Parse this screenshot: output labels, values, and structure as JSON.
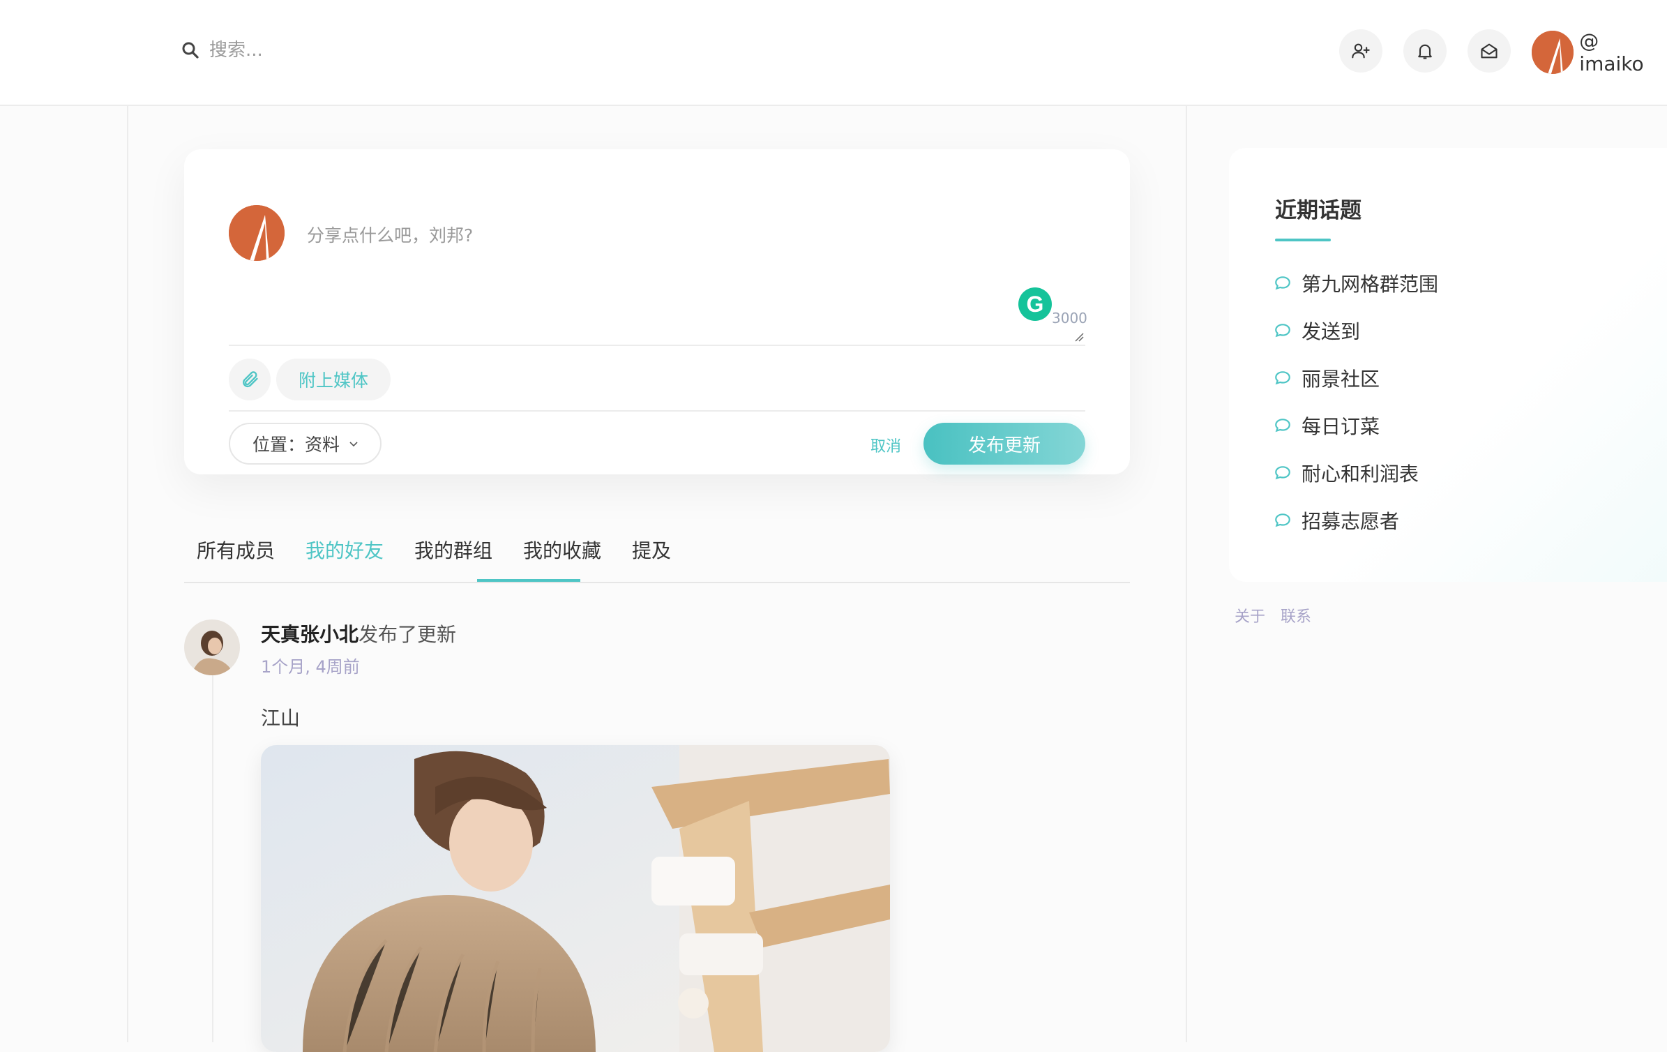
{
  "header": {
    "search_placeholder": "搜索...",
    "username": "@ imaiko",
    "icons": [
      "add-friend-icon",
      "bell-icon",
      "inbox-icon"
    ]
  },
  "composer": {
    "placeholder": "分享点什么吧，刘邦?",
    "char_count": "3000",
    "attach_media_label": "附上媒体",
    "location_label": "位置：资料",
    "cancel_label": "取消",
    "publish_label": "发布更新"
  },
  "tabs": [
    {
      "label": "所有成员",
      "active": false
    },
    {
      "label": "我的好友",
      "active": true
    },
    {
      "label": "我的群组",
      "active": false
    },
    {
      "label": "我的收藏",
      "active": false
    },
    {
      "label": "提及",
      "active": false
    }
  ],
  "post": {
    "author": "天真张小北",
    "action": "发布了更新",
    "time": "1个月, 4周前",
    "text": "江山"
  },
  "sidebar": {
    "title": "近期话题",
    "topics": [
      "第九网格群范围",
      "发送到",
      "丽景社区",
      "每日订菜",
      "耐心和利润表",
      "招募志愿者"
    ]
  },
  "footer": {
    "about": "关于",
    "contact": "联系"
  },
  "colors": {
    "accent": "#4ec5c5",
    "avatar_orange": "#d4663a",
    "muted_purple": "#a7a3c8"
  }
}
